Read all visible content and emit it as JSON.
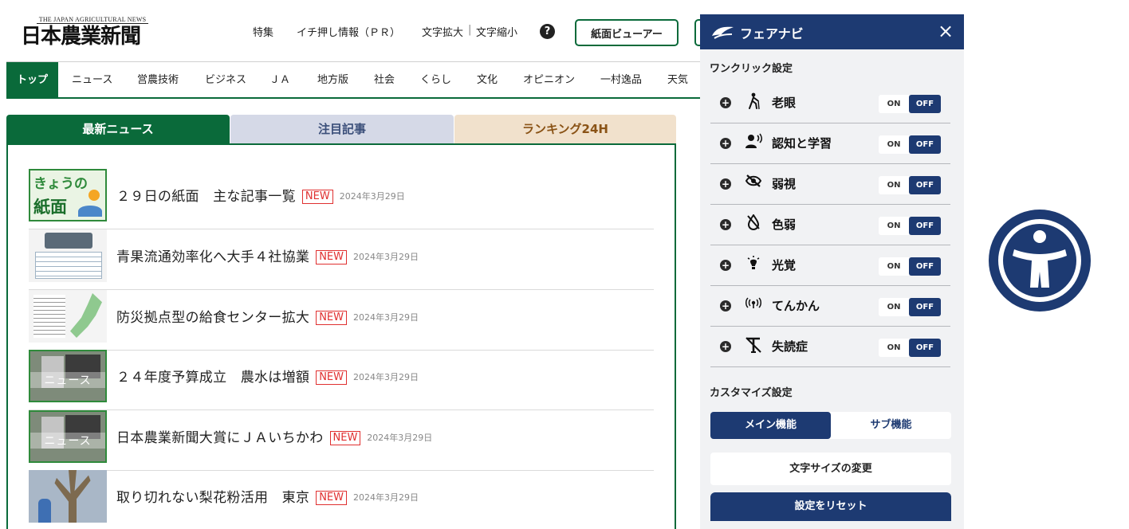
{
  "site": {
    "logo_sub": "THE JAPAN AGRICULTURAL NEWS",
    "logo_main": "日本農業新聞",
    "links": {
      "special": "特集",
      "pr": "イチ押し情報（ＰＲ）",
      "text_enlarge": "文字拡大",
      "text_shrink": "文字縮小",
      "separator": "|"
    },
    "help_icon": "?",
    "viewer_button": "紙面ビューアー"
  },
  "nav": {
    "items": [
      "トップ",
      "ニュース",
      "営農技術",
      "ビジネス",
      "ＪＡ",
      "地方版",
      "社会",
      "くらし",
      "文化",
      "オピニオン",
      "一村逸品",
      "天気"
    ]
  },
  "tabs": {
    "latest": "最新ニュース",
    "featured": "注目記事",
    "ranking": "ランキング24H"
  },
  "news": {
    "badge": "NEW",
    "items": [
      {
        "title": "２９日の紙面　主な記事一覧",
        "date": "2024年3月29日"
      },
      {
        "title": "青果流通効率化へ大手４社協業",
        "date": "2024年3月29日"
      },
      {
        "title": "防災拠点型の給食センター拡大",
        "date": "2024年3月29日"
      },
      {
        "title": "２４年度予算成立　農水は増額",
        "date": "2024年3月29日"
      },
      {
        "title": "日本農業新聞大賞にＪＡいちかわ",
        "date": "2024年3月29日"
      },
      {
        "title": "取り切れない梨花粉活用　東京",
        "date": "2024年3月29日"
      }
    ],
    "thumb_text": {
      "paper_line1": "きょうの",
      "paper_line2": "紙面",
      "news_band": "ニュース"
    }
  },
  "a11y_panel": {
    "title": "フェアナビ",
    "close_icon": "×",
    "one_click_title": "ワンクリック設定",
    "on_label": "ON",
    "off_label": "OFF",
    "modes": [
      {
        "label": "老眼",
        "icon": "walking-cane-icon"
      },
      {
        "label": "認知と学習",
        "icon": "person-speaking-icon"
      },
      {
        "label": "弱視",
        "icon": "eye-slash-icon"
      },
      {
        "label": "色弱",
        "icon": "color-drop-slash-icon"
      },
      {
        "label": "光覚",
        "icon": "lightbulb-icon"
      },
      {
        "label": "てんかん",
        "icon": "signal-waves-icon"
      },
      {
        "label": "失読症",
        "icon": "text-slash-icon"
      }
    ],
    "customize_title": "カスタマイズ設定",
    "subtab_main": "メイン機能",
    "subtab_sub": "サブ機能",
    "text_size_button": "文字サイズの変更",
    "reset_button": "設定をリセット"
  },
  "colors": {
    "site_green": "#0a6a3a",
    "panel_navy": "#1d3a72",
    "new_red": "#e03030",
    "tab_featured_bg": "#d5d9e7",
    "tab_ranking_bg": "#f1e1cc"
  }
}
